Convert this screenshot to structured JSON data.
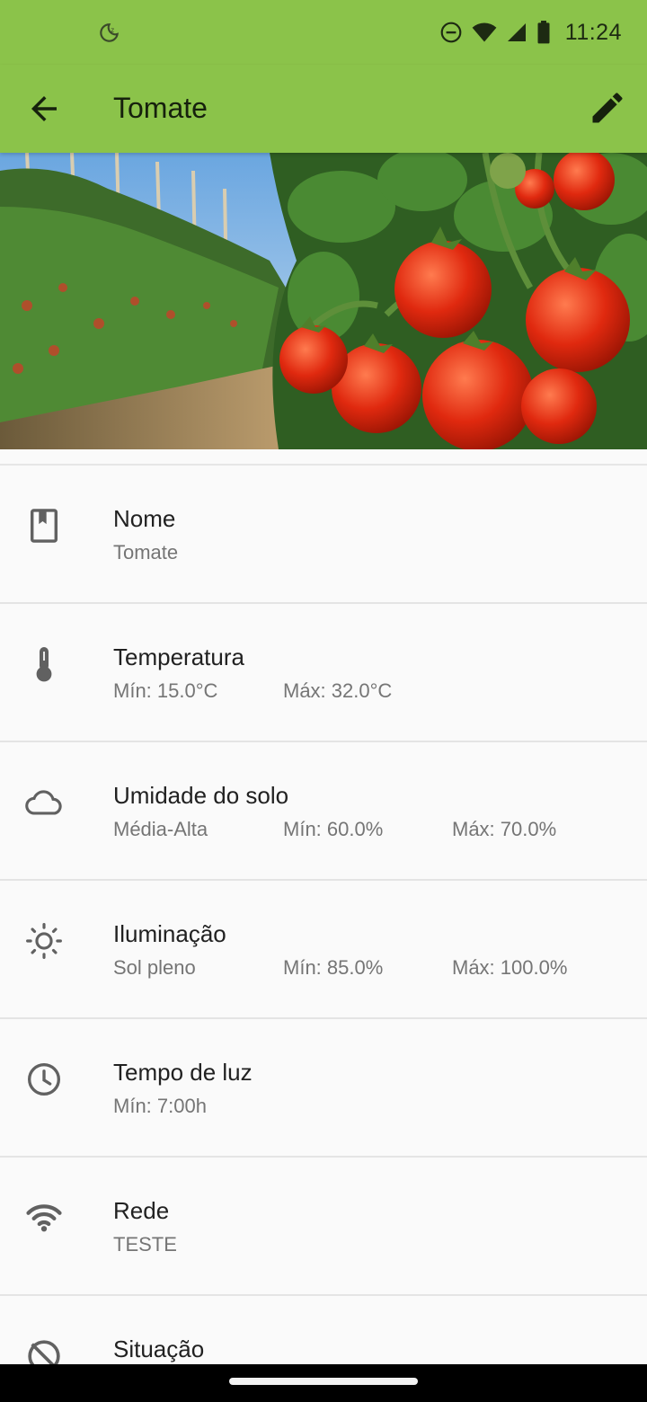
{
  "status_bar": {
    "time": "11:24",
    "icons": [
      "do-not-disturb-icon",
      "wifi-icon",
      "signal-icon",
      "battery-icon",
      "bedtime-moon-icon"
    ]
  },
  "app_bar": {
    "title": "Tomate",
    "back_icon": "arrow-back-icon",
    "edit_icon": "pencil-icon"
  },
  "hero_image": {
    "subject": "tomato-plants-photo"
  },
  "colors": {
    "accent": "#8bc34a",
    "text_primary": "#212121",
    "text_secondary": "#757575",
    "icon": "#616161"
  },
  "details": {
    "name": {
      "label": "Nome",
      "value": "Tomate",
      "icon": "book-icon"
    },
    "temperature": {
      "label": "Temperatura",
      "min": "Mín: 15.0°C",
      "max": "Máx: 32.0°C",
      "icon": "thermometer-icon"
    },
    "soil_moisture": {
      "label": "Umidade do solo",
      "level": "Média-Alta",
      "min": "Mín: 60.0%",
      "max": "Máx: 70.0%",
      "icon": "cloud-icon"
    },
    "lighting": {
      "label": "Iluminação",
      "level": "Sol pleno",
      "min": "Mín: 85.0%",
      "max": "Máx: 100.0%",
      "icon": "sun-icon"
    },
    "light_time": {
      "label": "Tempo de luz",
      "min": "Mín: 7:00h",
      "icon": "clock-icon"
    },
    "network": {
      "label": "Rede",
      "value": "TESTE",
      "icon": "wifi-icon"
    },
    "status": {
      "label": "Situação",
      "icon": "sync-disabled-icon"
    }
  }
}
